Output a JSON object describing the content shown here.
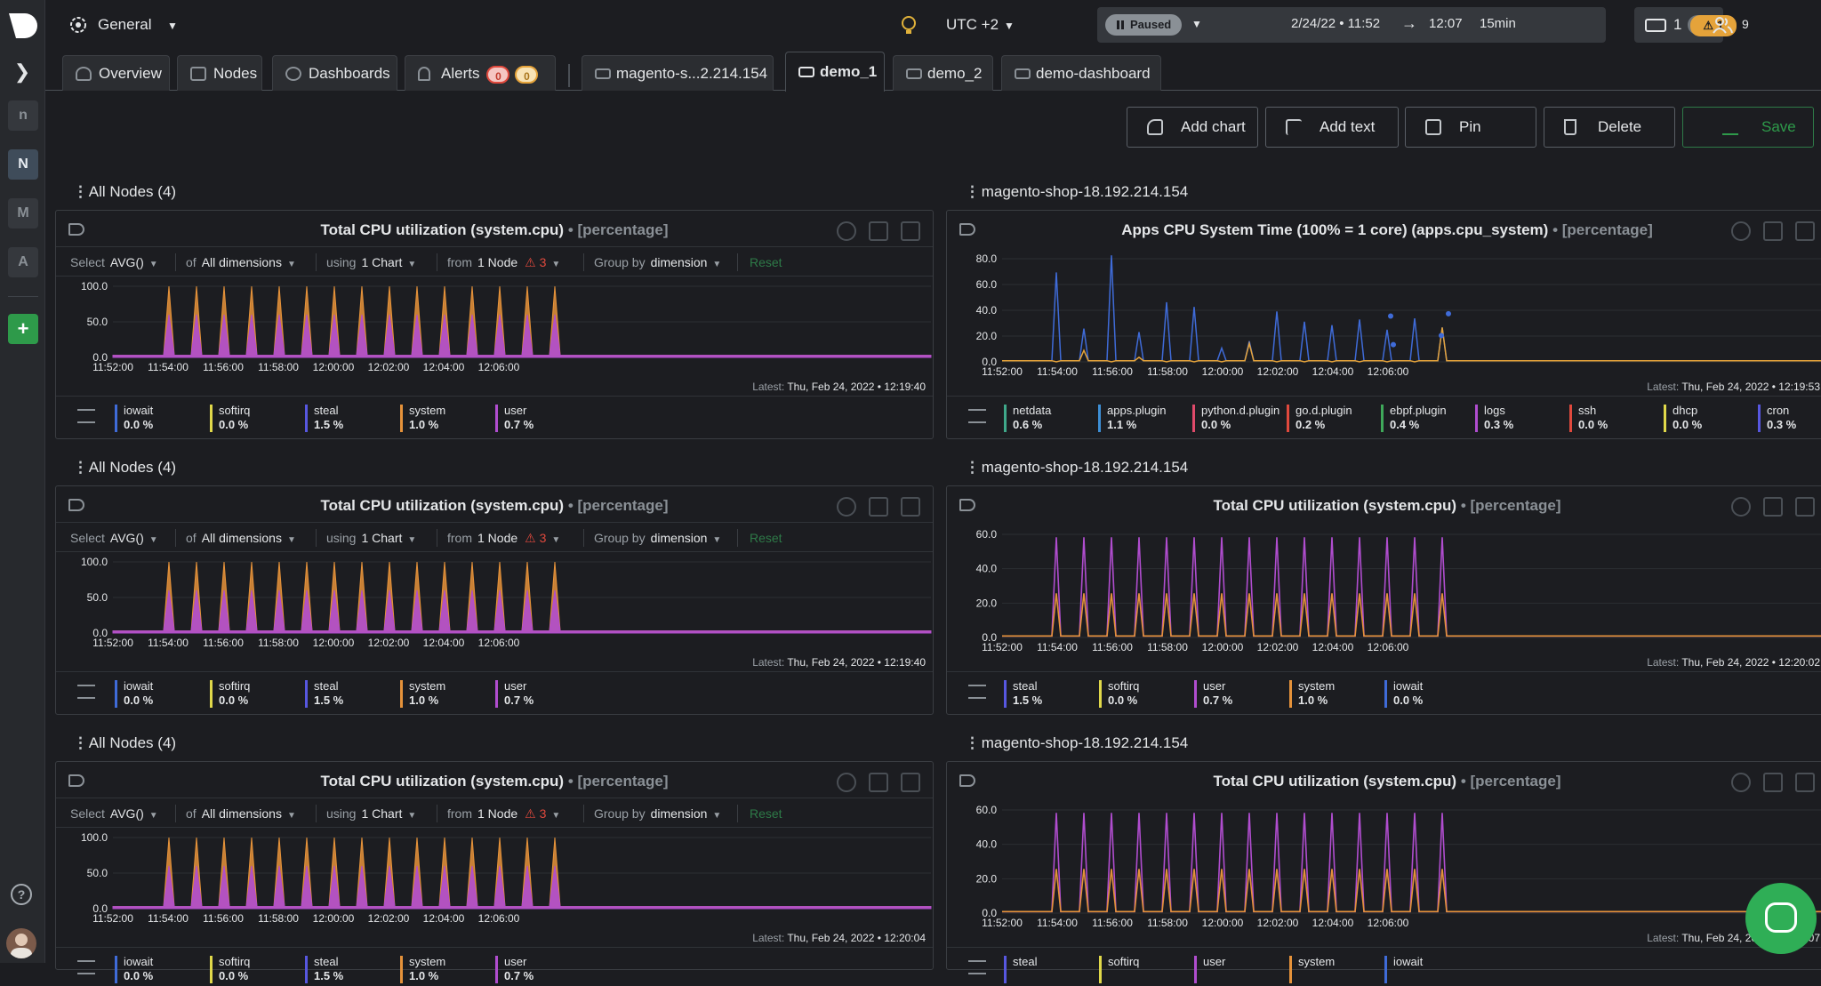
{
  "space": {
    "name": "General",
    "timezone": "UTC +2"
  },
  "playback": {
    "state": "Paused",
    "from": "2/24/22 • 11:52",
    "arrow": "→",
    "to": "12:07",
    "duration": "15min"
  },
  "header": {
    "nodes_live": "1",
    "nodes_offline": "3",
    "alerts": "1",
    "members": "9"
  },
  "rail": {
    "spaces": [
      "n",
      "N",
      "M",
      "A"
    ],
    "add": "+",
    "help": "?"
  },
  "tabs": {
    "overview": "Overview",
    "nodes": "Nodes",
    "dashboards": "Dashboards",
    "alerts": "Alerts",
    "alerts_critical": "0",
    "alerts_warning": "0",
    "node_tab": "magento-s...2.214.154",
    "demo1": "demo_1",
    "demo2": "demo_2",
    "demo_dash": "demo-dashboard"
  },
  "actions": {
    "add_chart": "Add chart",
    "add_text": "Add text",
    "pin": "Pin",
    "delete": "Delete",
    "save": "Save"
  },
  "colors": {
    "iowait": "#3f6bd8",
    "softirq": "#e0d84a",
    "steal": "#5757e0",
    "system": "#e5923a",
    "user": "#b04dcf",
    "accent": "#2e9a4a",
    "warn": "#e0493d"
  },
  "controls": {
    "select": "Select",
    "avg": "AVG()",
    "of": "of",
    "all_dims": "All dimensions",
    "using": "using",
    "one_chart": "1 Chart",
    "from": "from",
    "one_node": "1 Node",
    "node_warn": "3",
    "group_by": "Group by",
    "dimension": "dimension",
    "reset": "Reset"
  },
  "sections": [
    {
      "left_title": "All Nodes (4)",
      "right_title": "magento-shop-18.192.214.154"
    },
    {
      "left_title": "All Nodes (4)",
      "right_title": "magento-shop-18.192.214.154"
    },
    {
      "left_title": "All Nodes (4)",
      "right_title": "magento-shop-18.192.214.154"
    }
  ],
  "panels": {
    "cpu_all": {
      "title": "Total CPU utilization (system.cpu)",
      "unit": "• [percentage]"
    },
    "apps": {
      "title": "Apps CPU System Time (100% = 1 core) (apps.cpu_system)",
      "unit": "• [percentage]"
    },
    "cpu_node": {
      "title": "Total CPU utilization (system.cpu)",
      "unit": "• [percentage]"
    }
  },
  "latest": {
    "label": "Latest:",
    "l1": "Thu, Feb 24, 2022 • 12:19:40",
    "r1": "Thu, Feb 24, 2022 • 12:19:53",
    "l2": "Thu, Feb 24, 2022 • 12:19:40",
    "r2": "Thu, Feb 24, 2022 • 12:20:02",
    "l3": "Thu, Feb 24, 2022 • 12:20:04",
    "r3": "Thu, Feb 24, 2022 • 12:20:07"
  },
  "legend_all": [
    {
      "name": "iowait",
      "value": "0.0 %"
    },
    {
      "name": "softirq",
      "value": "0.0 %"
    },
    {
      "name": "steal",
      "value": "1.5 %"
    },
    {
      "name": "system",
      "value": "1.0 %"
    },
    {
      "name": "user",
      "value": "0.7 %"
    }
  ],
  "legend_apps": [
    {
      "name": "netdata",
      "value": "0.6 %",
      "color": "#3fa88a"
    },
    {
      "name": "apps.plugin",
      "value": "1.1 %",
      "color": "#3d8fd6"
    },
    {
      "name": "python.d.plugin",
      "value": "0.0 %",
      "color": "#e04a6a"
    },
    {
      "name": "go.d.plugin",
      "value": "0.2 %",
      "color": "#e0493d"
    },
    {
      "name": "ebpf.plugin",
      "value": "0.4 %",
      "color": "#3fa85a"
    },
    {
      "name": "logs",
      "value": "0.3 %",
      "color": "#b04dcf"
    },
    {
      "name": "ssh",
      "value": "0.0 %",
      "color": "#e0493d"
    },
    {
      "name": "dhcp",
      "value": "0.0 %",
      "color": "#e0d84a"
    },
    {
      "name": "cron",
      "value": "0.3 %",
      "color": "#5757e0"
    }
  ],
  "legend_node": [
    {
      "name": "steal",
      "value": "1.5 %",
      "color": "#5757e0"
    },
    {
      "name": "softirq",
      "value": "0.0 %",
      "color": "#e0d84a"
    },
    {
      "name": "user",
      "value": "0.7 %",
      "color": "#b04dcf"
    },
    {
      "name": "system",
      "value": "1.0 %",
      "color": "#e5923a"
    },
    {
      "name": "iowait",
      "value": "0.0 %",
      "color": "#3f6bd8"
    }
  ],
  "legend_node_bottom": [
    {
      "name": "steal",
      "value": "",
      "color": "#5757e0"
    },
    {
      "name": "softirq",
      "value": "",
      "color": "#e0d84a"
    },
    {
      "name": "user",
      "value": "",
      "color": "#b04dcf"
    },
    {
      "name": "system",
      "value": "",
      "color": "#e5923a"
    },
    {
      "name": "iowait",
      "value": "",
      "color": "#3f6bd8"
    }
  ],
  "chart_data": [
    {
      "type": "area",
      "name": "system.cpu (All Nodes) stacked",
      "ylim": [
        0,
        100
      ],
      "yticks": [
        "100.0",
        "50.0",
        "0.0"
      ],
      "xticks": [
        "11:52:00",
        "11:54:00",
        "11:56:00",
        "11:58:00",
        "12:00:00",
        "12:02:00",
        "12:04:00",
        "12:06:00"
      ],
      "spike_times": [
        "11:52:20",
        "11:53:20",
        "11:54:20",
        "11:55:20",
        "11:56:20",
        "11:57:20",
        "11:58:20",
        "11:59:20",
        "12:00:20",
        "12:01:20",
        "12:02:20",
        "12:03:20",
        "12:04:20",
        "12:05:20",
        "12:06:20"
      ],
      "series": [
        {
          "name": "system",
          "peak": 100
        },
        {
          "name": "user",
          "peak": 60
        }
      ],
      "baseline": 3
    },
    {
      "type": "line",
      "name": "apps.cpu_system",
      "ylim": [
        0,
        90
      ],
      "yticks": [
        "80.0",
        "60.0",
        "40.0",
        "20.0",
        "0.0"
      ],
      "xticks": [
        "11:52:00",
        "11:54:00",
        "11:56:00",
        "11:58:00",
        "12:00:00",
        "12:02:00",
        "12:04:00",
        "12:06:00"
      ],
      "series": [
        {
          "name": "cron",
          "spikes": [
            78,
            29,
            93,
            26,
            52,
            48,
            12,
            18,
            44,
            35,
            32,
            37,
            28,
            38,
            30
          ]
        },
        {
          "name": "go.d.plugin",
          "spikes": [
            0,
            10,
            0,
            4,
            0,
            0,
            0,
            16,
            0,
            0,
            0,
            0,
            0,
            0,
            30
          ]
        }
      ]
    },
    {
      "type": "line",
      "name": "system.cpu (node)",
      "ylim": [
        0,
        70
      ],
      "yticks": [
        "60.0",
        "40.0",
        "20.0",
        "0.0"
      ],
      "xticks": [
        "11:52:00",
        "11:54:00",
        "11:56:00",
        "11:58:00",
        "12:00:00",
        "12:02:00",
        "12:04:00",
        "12:06:00"
      ],
      "series": [
        {
          "name": "user",
          "peak": 68
        },
        {
          "name": "system",
          "peak": 30
        }
      ]
    }
  ]
}
